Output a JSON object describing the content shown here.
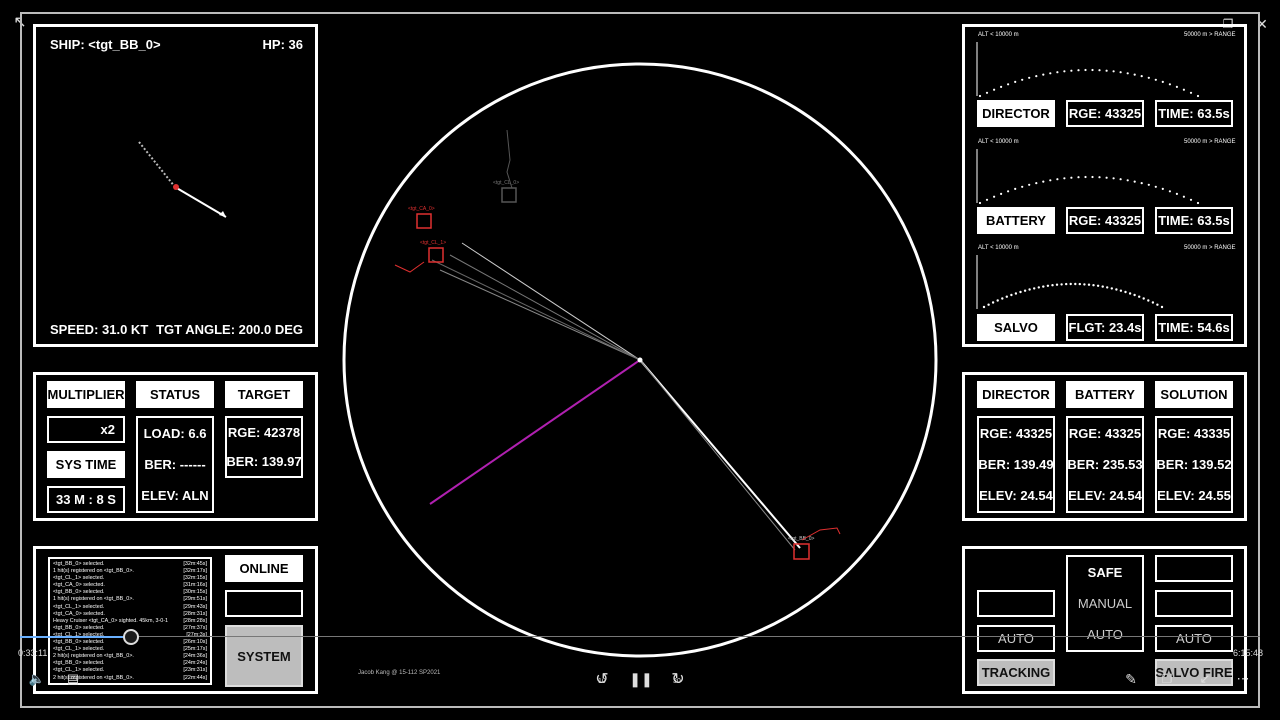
{
  "ship_panel": {
    "ship": "SHIP: <tgt_BB_0>",
    "hp": "HP: 36",
    "speed": "SPEED: 31.0 KT",
    "tgt_angle": "TGT ANGLE: 200.0 DEG"
  },
  "control_panel": {
    "multiplier_label": "MULTIPLIER",
    "multiplier_value": "x2",
    "sys_time_label": "SYS TIME",
    "sys_time_value": "33 M : 8 S",
    "status_label": "STATUS",
    "load": "LOAD: 6.6",
    "ber": "BER: ------",
    "elev": "ELEV: ALN",
    "target_label": "TARGET",
    "target_rge": "RGE: 42378",
    "target_ber": "BER: 139.97"
  },
  "log_panel": {
    "lines": [
      {
        "text": "<tgt_BB_0> selected.",
        "time": "[32m:45s]"
      },
      {
        "text": "1 hit(s) registered on <tgt_BB_0>.",
        "time": "[32m:17s]"
      },
      {
        "text": "<tgt_CL_1> selected.",
        "time": "[32m:15s]"
      },
      {
        "text": "<tgt_CA_0> selected.",
        "time": "[31m:16s]"
      },
      {
        "text": "<tgt_BB_0> selected.",
        "time": "[30m:15s]"
      },
      {
        "text": "1 hit(s) registered on <tgt_BB_0>.",
        "time": "[29m:51s]"
      },
      {
        "text": "<tgt_CL_1> selected.",
        "time": "[29m:43s]"
      },
      {
        "text": "<tgt_CA_0> selected.",
        "time": "[28m:31s]"
      },
      {
        "text": "Heavy Cruiser <tgt_CA_0> sighted. 45km, 3-0-1",
        "time": "[28m:28s]"
      },
      {
        "text": "<tgt_BB_0> selected.",
        "time": "[27m:37s]"
      },
      {
        "text": "<tgt_CL_1> selected.",
        "time": "[27m:3s]"
      },
      {
        "text": "<tgt_BB_0> selected.",
        "time": "[26m:10s]"
      },
      {
        "text": "<tgt_CL_1> selected.",
        "time": "[25m:17s]"
      },
      {
        "text": "2 hit(s) registered on <tgt_BB_0>.",
        "time": "[24m:36s]"
      },
      {
        "text": "<tgt_BB_0> selected.",
        "time": "[24m:24s]"
      },
      {
        "text": "<tgt_CL_1> selected.",
        "time": "[23m:31s]"
      },
      {
        "text": "2 hit(s) registered on <tgt_BB_0>.",
        "time": "[22m:44s]"
      }
    ],
    "online_label": "ONLINE",
    "system_label": "SYSTEM"
  },
  "radar": {
    "targets": [
      {
        "label": "<tgt_CA_0>",
        "color": "#e03030"
      },
      {
        "label": "<tgt_CL_1>",
        "color": "#e03030"
      },
      {
        "label": "<tgt_CL_0>",
        "color": "#888888"
      },
      {
        "label": "<tgt_BB_0>",
        "color": "#e03030"
      }
    ],
    "credit": "Jacob Kang @ 15-112 SP2021"
  },
  "trajectory_panel": {
    "director": {
      "alt_label": "ALT < 10000 m",
      "range_label": "50000 m > RANGE",
      "name": "DIRECTOR",
      "rge": "RGE: 43325",
      "time": "TIME: 63.5s"
    },
    "battery": {
      "alt_label": "ALT < 10000 m",
      "range_label": "50000 m > RANGE",
      "name": "BATTERY",
      "rge": "RGE: 43325",
      "time": "TIME: 63.5s"
    },
    "salvo": {
      "alt_label": "ALT < 10000 m",
      "range_label": "50000 m > RANGE",
      "name": "SALVO",
      "flgt": "FLGT: 23.4s",
      "time": "TIME: 54.6s"
    }
  },
  "solution_panel": {
    "columns": [
      {
        "name": "DIRECTOR",
        "rge": "RGE: 43325",
        "ber": "BER: 139.49",
        "elev": "ELEV: 24.54"
      },
      {
        "name": "BATTERY",
        "rge": "RGE: 43325",
        "ber": "BER: 235.53",
        "elev": "ELEV: 24.54"
      },
      {
        "name": "SOLUTION",
        "rge": "RGE: 43335",
        "ber": "BER: 139.52",
        "elev": "ELEV: 24.55"
      }
    ]
  },
  "fire_panel": {
    "left_auto": "AUTO",
    "tracking": "TRACKING",
    "safe": "SAFE",
    "manual": "MANUAL",
    "center_auto": "AUTO",
    "right_auto": "AUTO",
    "salvo_fire": "SALVO FIRE"
  },
  "player": {
    "elapsed": "0:33:11",
    "total": "6:15:48",
    "progress": 0.088,
    "skip_back": "10",
    "skip_forward": "30"
  }
}
